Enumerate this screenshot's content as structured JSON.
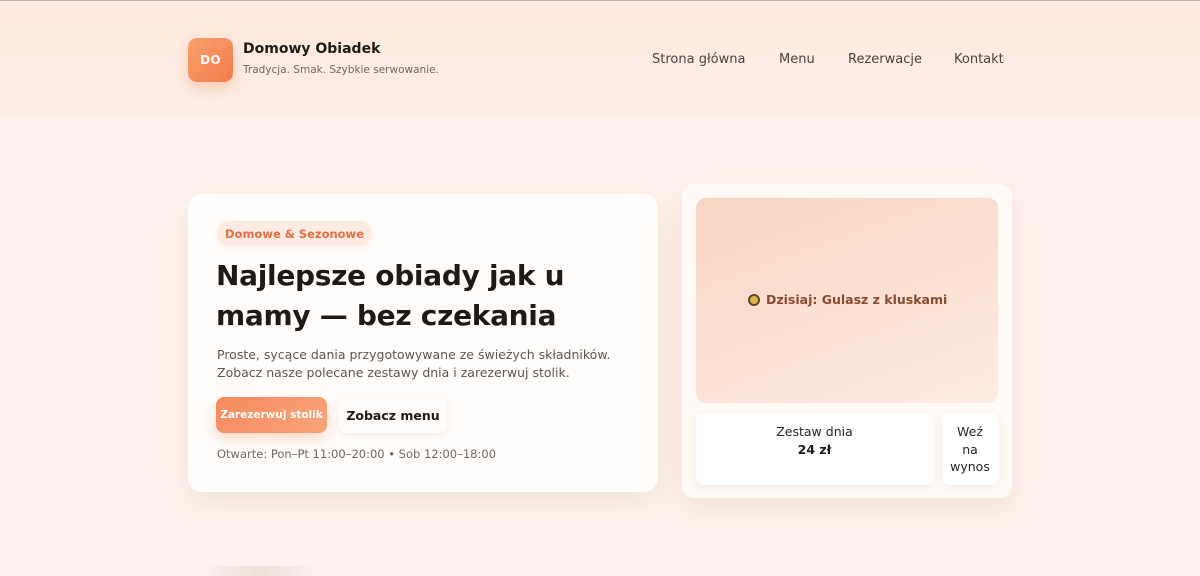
{
  "header": {
    "logo_initials": "DO",
    "brand_name": "Domowy Obiadek",
    "tagline": "Tradycja. Smak. Szybkie serwowanie.",
    "nav": [
      {
        "label": "Strona główna"
      },
      {
        "label": "Menu"
      },
      {
        "label": "Rezerwacje"
      },
      {
        "label": "Kontakt"
      }
    ]
  },
  "hero": {
    "badge": "Domowe & Sezonowe",
    "title_line1": "Najlepsze obiady jak u",
    "title_line2": "mamy — bez czekania",
    "desc_line1": "Proste, sycące dania przygotowywane ze świeżych składników.",
    "desc_line2": "Zobacz nasze polecane zestawy dnia i zarezerwuj stolik.",
    "primary_button": "Zarezerwuj stolik",
    "secondary_button": "Zobacz menu",
    "hours": "Otwarte: Pon–Pt 11:00–20:00 • Sob 12:00–18:00"
  },
  "today": {
    "icon": "dish-icon",
    "label": "Dzisiaj: Gulasz z kluskami",
    "set_label": "Zestaw dnia",
    "set_price": "24 zł",
    "takeaway_line1": "Weź",
    "takeaway_line2": "na",
    "takeaway_line3": "wynos"
  },
  "colors": {
    "accent": "#f27b4c",
    "background": "#fdf3ec"
  }
}
